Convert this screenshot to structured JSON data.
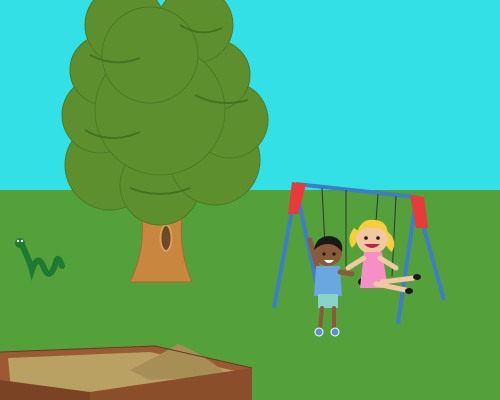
{
  "scene": {
    "sky_color": "#33e0e6",
    "grass_color": "#54a03a",
    "objects": {
      "tree": {
        "icon": "oak-tree"
      },
      "snake": {
        "icon": "green-snake"
      },
      "swing_set": {
        "icon": "swing-set",
        "frame_color": "#3d7fc6",
        "top_corner_color": "#e83a3a"
      },
      "boy": {
        "icon": "boy-child",
        "shirt_color": "#6aa7e0"
      },
      "girl": {
        "icon": "girl-child",
        "dress_color": "#f58fc6"
      },
      "sandbox": {
        "icon": "sandbox",
        "frame_color": "#9c5a33",
        "sand_color": "#b9a063"
      }
    }
  }
}
